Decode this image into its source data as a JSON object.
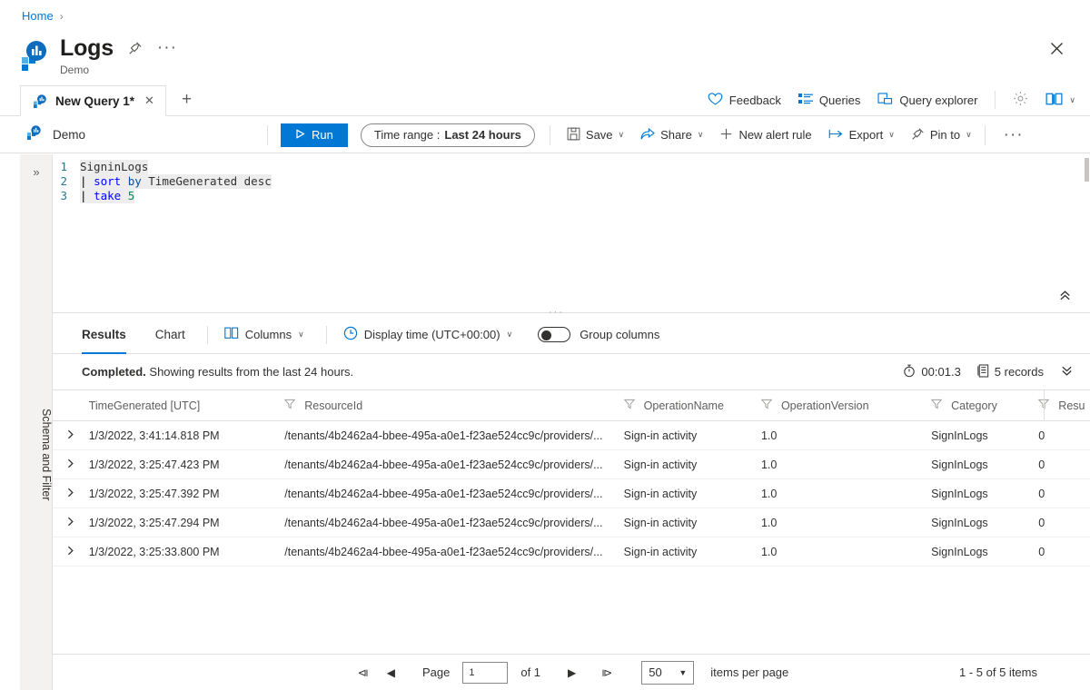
{
  "breadcrumb": {
    "home": "Home",
    "separator": "›"
  },
  "header": {
    "title": "Logs",
    "subtitle": "Demo",
    "pin_icon": "pin-icon",
    "more_icon": "ellipsis-icon",
    "close_icon": "close-icon"
  },
  "tabs": {
    "query_tab_label": "New Query 1*",
    "close_icon": "close-icon",
    "add_label": "+"
  },
  "topbar": {
    "feedback": "Feedback",
    "queries": "Queries",
    "query_explorer": "Query explorer",
    "settings_icon": "gear-icon",
    "book_icon": "book-icon",
    "book_chevron": "∨"
  },
  "commandbar": {
    "scope_name": "Demo",
    "run_label": "Run",
    "run_icon": "play-icon",
    "time_range_label": "Time range :",
    "time_range_value": "Last 24 hours",
    "save_label": "Save",
    "share_label": "Share",
    "new_alert_label": "New alert rule",
    "export_label": "Export",
    "pin_to_label": "Pin to",
    "more_icon": "ellipsis-icon",
    "chevron": "∨"
  },
  "rail": {
    "expand_icon": "double-chevron-right-icon",
    "label": "Schema and Filter"
  },
  "editor": {
    "lines": [
      {
        "n": "1",
        "segments": [
          {
            "t": "SigninLogs",
            "c": "plain"
          }
        ]
      },
      {
        "n": "2",
        "segments": [
          {
            "t": "| ",
            "c": "pipe"
          },
          {
            "t": "sort ",
            "c": "kw-blue"
          },
          {
            "t": "by ",
            "c": "kw-dblue"
          },
          {
            "t": "TimeGenerated desc",
            "c": "plain"
          }
        ]
      },
      {
        "n": "3",
        "segments": [
          {
            "t": "| ",
            "c": "pipe"
          },
          {
            "t": "take ",
            "c": "kw-blue"
          },
          {
            "t": "5",
            "c": "num"
          }
        ]
      }
    ],
    "collapse_icon": "double-chevron-up-icon",
    "splitter_dots": "···"
  },
  "results": {
    "tab_results": "Results",
    "tab_chart": "Chart",
    "columns_label": "Columns",
    "columns_icon": "columns-icon",
    "display_time_label": "Display time (UTC+00:00)",
    "clock_icon": "clock-icon",
    "group_columns_label": "Group columns",
    "status_bold": "Completed.",
    "status_rest": " Showing results from the last 24 hours.",
    "duration": "00:01.3",
    "duration_icon": "timer-icon",
    "records": "5 records",
    "records_icon": "records-icon",
    "expand_icon": "double-chevron-down-icon"
  },
  "table": {
    "columns": [
      {
        "key": "time",
        "label": "TimeGenerated [UTC]",
        "filter": false
      },
      {
        "key": "resource",
        "label": "ResourceId",
        "filter": true
      },
      {
        "key": "opname",
        "label": "OperationName",
        "filter": true
      },
      {
        "key": "opver",
        "label": "OperationVersion",
        "filter": true
      },
      {
        "key": "category",
        "label": "Category",
        "filter": true
      },
      {
        "key": "result",
        "label": "Resu",
        "filter": true
      }
    ],
    "expander_icon": "chevron-right-icon",
    "rows": [
      {
        "time": "1/3/2022, 3:41:14.818 PM",
        "resource": "/tenants/4b2462a4-bbee-495a-a0e1-f23ae524cc9c/providers/...",
        "opname": "Sign-in activity",
        "opver": "1.0",
        "category": "SignInLogs",
        "result": "0"
      },
      {
        "time": "1/3/2022, 3:25:47.423 PM",
        "resource": "/tenants/4b2462a4-bbee-495a-a0e1-f23ae524cc9c/providers/...",
        "opname": "Sign-in activity",
        "opver": "1.0",
        "category": "SignInLogs",
        "result": "0"
      },
      {
        "time": "1/3/2022, 3:25:47.392 PM",
        "resource": "/tenants/4b2462a4-bbee-495a-a0e1-f23ae524cc9c/providers/...",
        "opname": "Sign-in activity",
        "opver": "1.0",
        "category": "SignInLogs",
        "result": "0"
      },
      {
        "time": "1/3/2022, 3:25:47.294 PM",
        "resource": "/tenants/4b2462a4-bbee-495a-a0e1-f23ae524cc9c/providers/...",
        "opname": "Sign-in activity",
        "opver": "1.0",
        "category": "SignInLogs",
        "result": "0"
      },
      {
        "time": "1/3/2022, 3:25:33.800 PM",
        "resource": "/tenants/4b2462a4-bbee-495a-a0e1-f23ae524cc9c/providers/...",
        "opname": "Sign-in activity",
        "opver": "1.0",
        "category": "SignInLogs",
        "result": "0"
      }
    ]
  },
  "pager": {
    "first_icon": "⧏",
    "prev_icon": "◀",
    "page_label": "Page",
    "page_value": "1",
    "of_label": "of 1",
    "next_icon": "▶",
    "last_icon": "⧐",
    "page_size": "50",
    "page_size_chevron": "▼",
    "items_per_page_label": "items per page",
    "total_label": "1 - 5 of 5 items"
  },
  "colors": {
    "accent": "#0078d4",
    "border": "#e1dfdd",
    "rail": "#f3f2f1"
  }
}
